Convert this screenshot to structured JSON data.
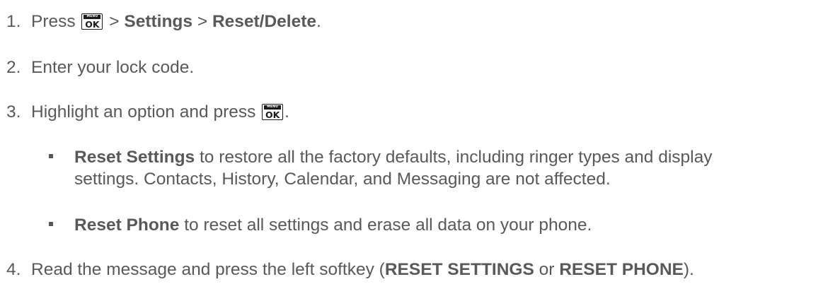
{
  "key_icon": {
    "top": "MENU",
    "bottom": "OK"
  },
  "step1": {
    "num": "1.",
    "t1": "Press ",
    "t2": " > ",
    "b1": "Settings",
    "t3": " > ",
    "b2": "Reset/Delete",
    "t4": "."
  },
  "step2": {
    "num": "2.",
    "t1": "Enter your lock code."
  },
  "step3": {
    "num": "3.",
    "t1": "Highlight an option and press ",
    "t2": "."
  },
  "bullet1": {
    "b1": "Reset Settings",
    "line1": " to restore all the factory defaults, including ringer types and display",
    "line2": "settings. Contacts, History, Calendar, and Messaging are not affected."
  },
  "bullet2": {
    "b1": "Reset Phone",
    "t1": " to reset all settings and erase all data on your phone."
  },
  "step4": {
    "num": "4.",
    "t1": "Read the message and press the left softkey (",
    "b1": "RESET SETTINGS",
    "t2": " or ",
    "b2": "RESET PHONE",
    "t3": ")."
  }
}
